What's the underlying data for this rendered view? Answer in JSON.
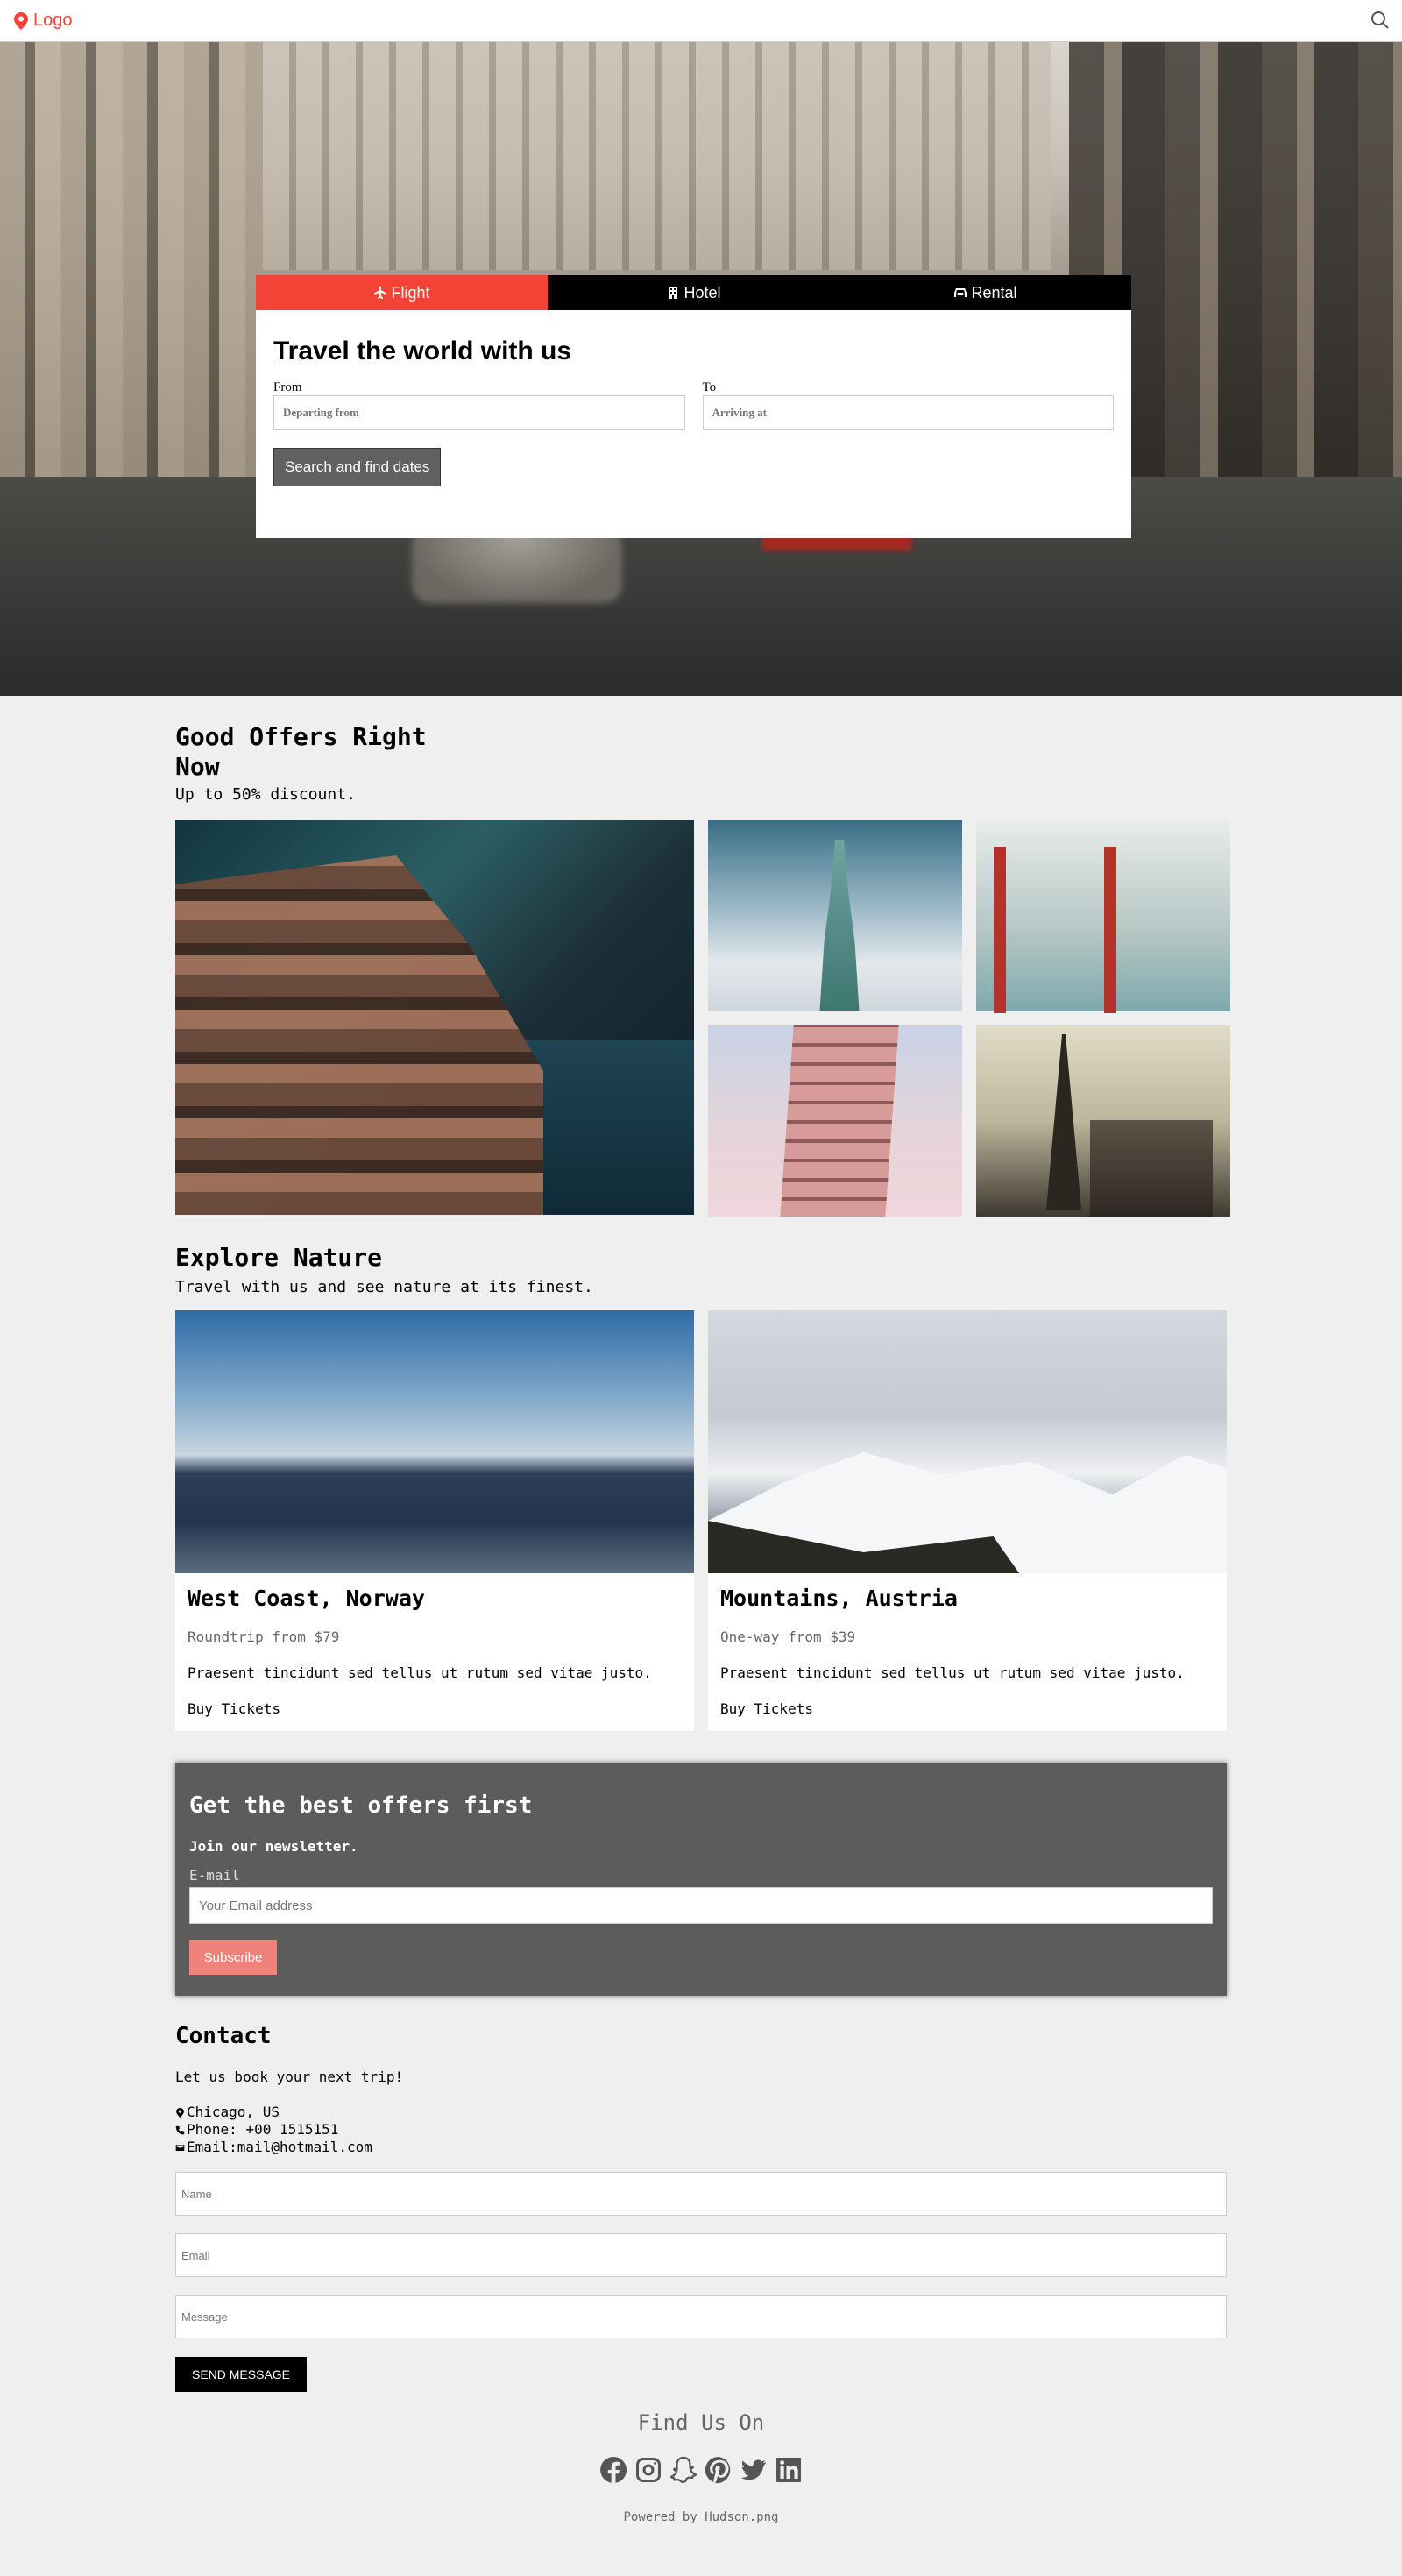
{
  "header": {
    "logo_label": "Logo"
  },
  "booking": {
    "tabs": [
      {
        "label": "Flight",
        "icon": "plane-icon",
        "active": true
      },
      {
        "label": "Hotel",
        "icon": "building-icon",
        "active": false
      },
      {
        "label": "Rental",
        "icon": "car-icon",
        "active": false
      }
    ],
    "title": "Travel the world with us",
    "from_label": "From",
    "from_placeholder": "Departing from",
    "to_label": "To",
    "to_placeholder": "Arriving at",
    "submit_label": "Search and find dates"
  },
  "offers": {
    "title": "Good Offers Right Now",
    "subtitle": "Up to 50% discount."
  },
  "nature": {
    "title": "Explore Nature",
    "subtitle": "Travel with us and see nature at its finest.",
    "cards": [
      {
        "title": "West Coast, Norway",
        "price": "Roundtrip from $79",
        "description": "Praesent tincidunt sed tellus ut rutum sed vitae justo.",
        "link": "Buy Tickets"
      },
      {
        "title": "Mountains, Austria",
        "price": "One-way from $39",
        "description": "Praesent tincidunt sed tellus ut rutum sed vitae justo.",
        "link": "Buy Tickets"
      }
    ]
  },
  "newsletter": {
    "title": "Get the best offers first",
    "subtitle": "Join our newsletter.",
    "email_label": "E-mail",
    "email_placeholder": "Your Email address",
    "submit_label": "Subscribe"
  },
  "contact": {
    "title": "Contact",
    "tagline": "Let us book your next trip!",
    "location": "Chicago, US",
    "phone": "Phone: +00 1515151",
    "email": "Email:mail@hotmail.com",
    "name_placeholder": "Name",
    "email_placeholder": "Email",
    "message_placeholder": "Message",
    "submit_label": "SEND MESSAGE"
  },
  "footer": {
    "find_us": "Find Us On",
    "socials": [
      "facebook-icon",
      "instagram-icon",
      "snapchat-icon",
      "pinterest-icon",
      "twitter-icon",
      "linkedin-icon"
    ],
    "powered_by": "Powered by Hudson.png"
  },
  "colors": {
    "accent": "#f44336",
    "dark": "#5c5c5c",
    "subscribe": "#f0827c",
    "background": "#efefef"
  }
}
